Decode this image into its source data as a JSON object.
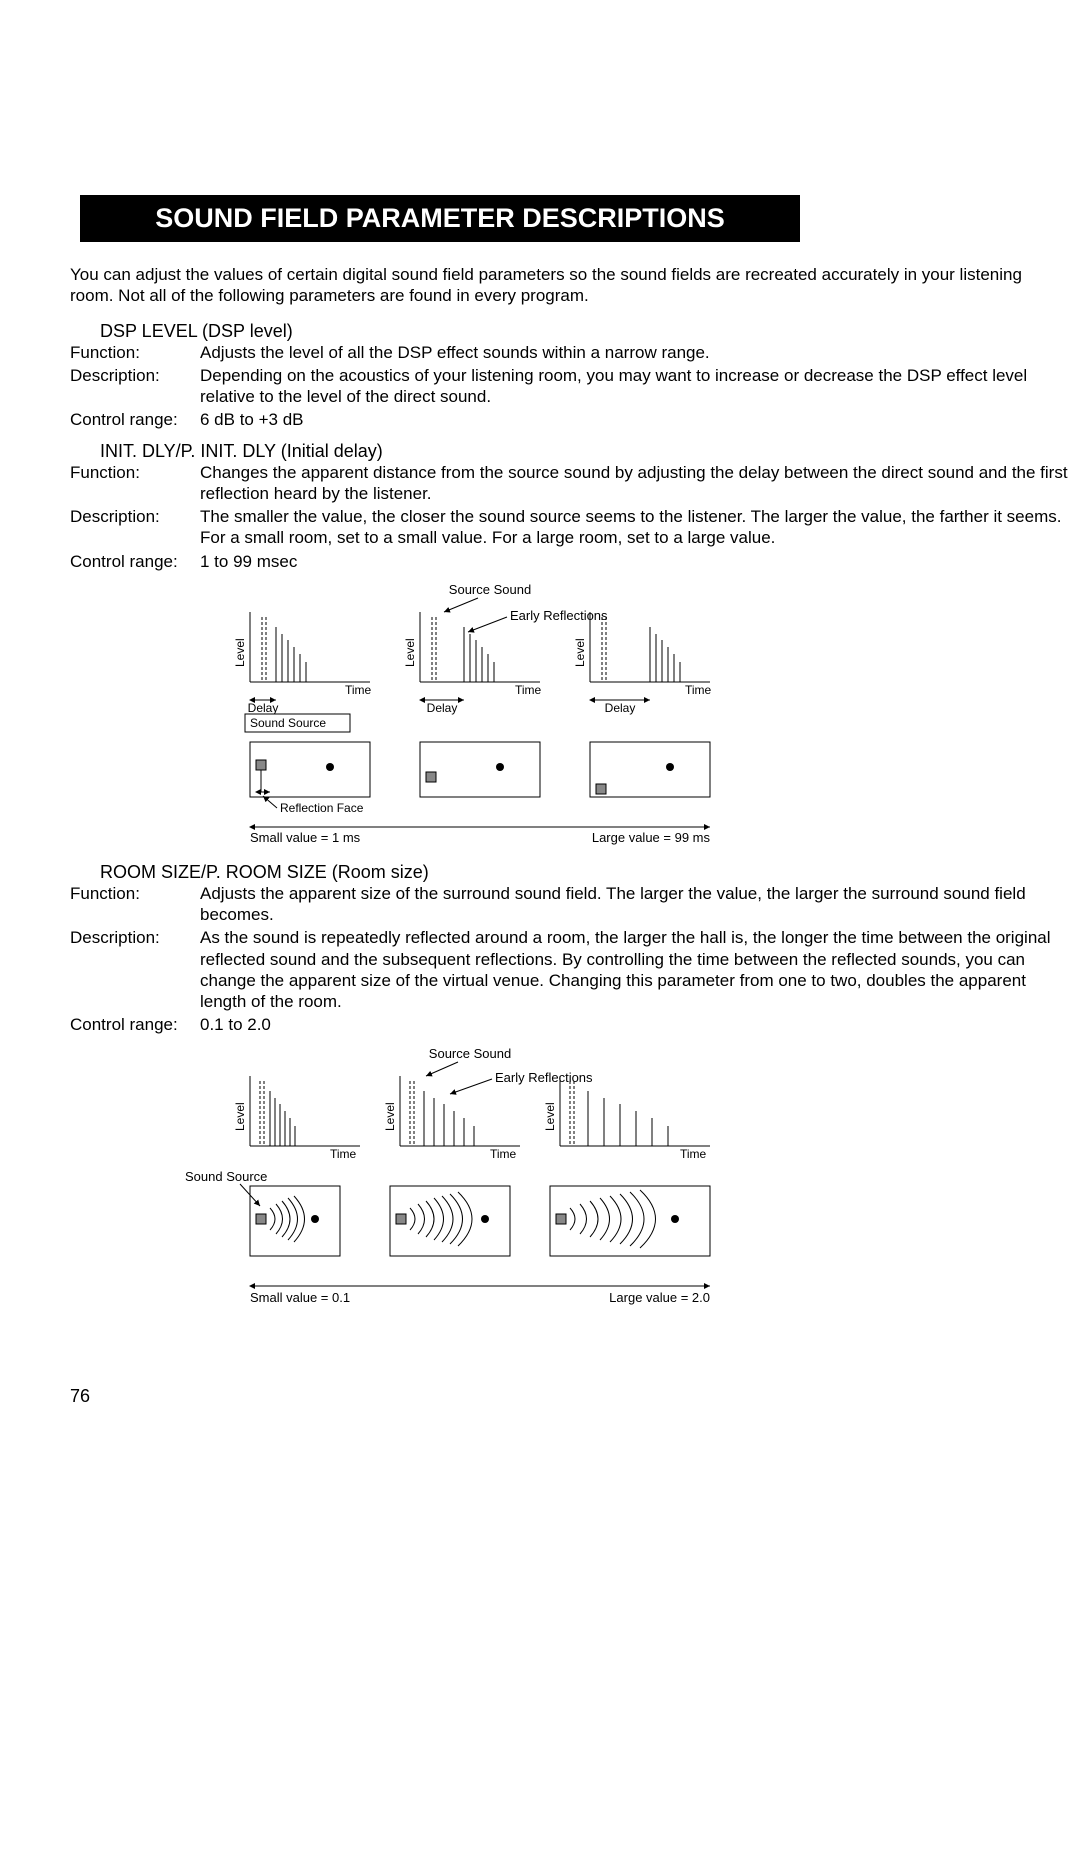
{
  "page": {
    "title": "SOUND FIELD PARAMETER DESCRIPTIONS",
    "intro": "You can adjust the values of certain digital sound field parameters so the sound fields are recreated accurately in your listening room. Not all of the following parameters are found in every program.",
    "number": "76"
  },
  "params": [
    {
      "title": "DSP LEVEL (DSP level)",
      "rows": [
        {
          "label": "Function:",
          "value": "Adjusts the level of all the DSP effect sounds within a narrow range."
        },
        {
          "label": "Description:",
          "value": "Depending on the acoustics of your listening room, you may want to increase or decrease the DSP effect level relative to the level of the direct sound."
        },
        {
          "label": "Control range:",
          "value": "6 dB to +3 dB"
        }
      ]
    },
    {
      "title": "INIT. DLY/P. INIT. DLY (Initial delay)",
      "rows": [
        {
          "label": "Function:",
          "value": "Changes the apparent distance from the source sound by adjusting the delay between the direct sound and the first reflection heard by the listener."
        },
        {
          "label": "Description:",
          "value": "The smaller the value, the closer the sound source seems to the listener. The larger the value, the farther it seems. For a small room, set to a small value. For a large room, set to a large value."
        },
        {
          "label": "Control range:",
          "value": "1 to 99 msec"
        }
      ]
    },
    {
      "title": "ROOM SIZE/P. ROOM SIZE (Room size)",
      "rows": [
        {
          "label": "Function:",
          "value": "Adjusts the apparent size of the surround sound field. The larger the value, the larger the surround sound field becomes."
        },
        {
          "label": "Description:",
          "value": "As the sound is repeatedly reflected around a room, the larger the hall is, the longer the time between the original reflected sound and the subsequent reflections. By controlling the time between the reflected sounds, you can change the apparent size of the virtual venue. Changing this parameter from one to two, doubles the apparent length of the room."
        },
        {
          "label": "Control range:",
          "value": "0.1 to 2.0"
        }
      ]
    }
  ],
  "diagram1": {
    "source_sound": "Source Sound",
    "early_reflections": "Early Reflections",
    "level": "Level",
    "time": "Time",
    "delay": "Delay",
    "sound_source": "Sound Source",
    "reflection_face": "Reflection Face",
    "small": "Small value = 1 ms",
    "large": "Large value = 99 ms"
  },
  "diagram2": {
    "source_sound": "Source Sound",
    "early_reflections": "Early Reflections",
    "level": "Level",
    "time": "Time",
    "sound_source": "Sound Source",
    "small": "Small value = 0.1",
    "large": "Large value = 2.0"
  }
}
